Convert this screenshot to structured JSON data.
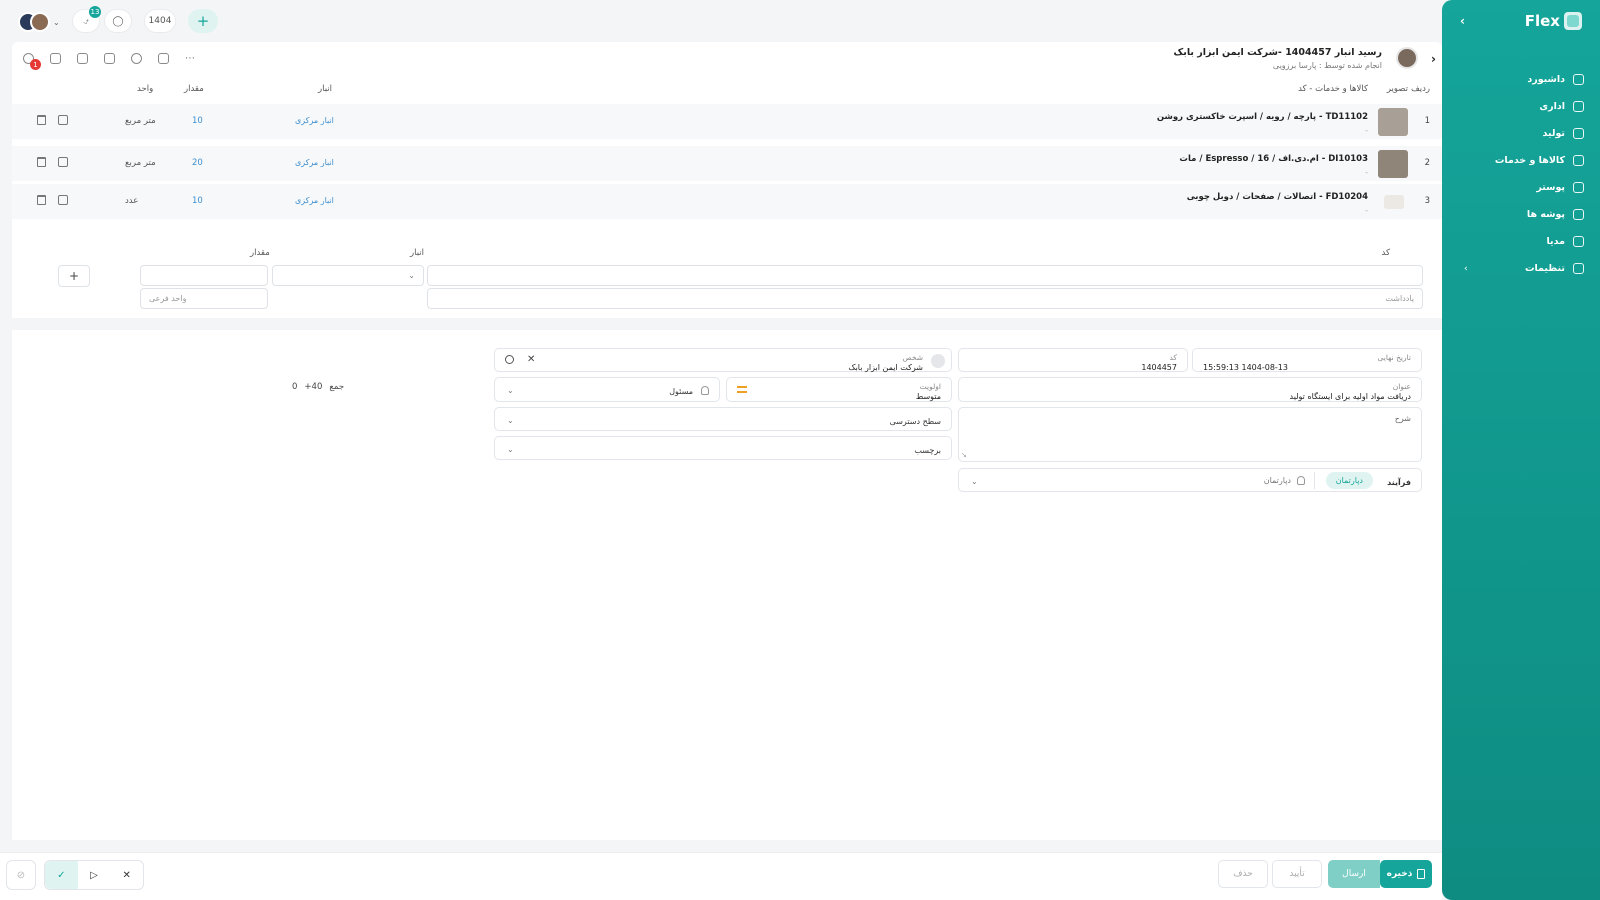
{
  "sidebar": {
    "brand": "Flex",
    "items": [
      {
        "label": "داشبورد"
      },
      {
        "label": "اداری"
      },
      {
        "label": "تولید"
      },
      {
        "label": "کالاها و خدمات"
      },
      {
        "label": "پوستر"
      },
      {
        "label": "پوشه ها"
      },
      {
        "label": "مدیا"
      },
      {
        "label": "تنظیمات"
      }
    ]
  },
  "topbar": {
    "notification_count": "13",
    "year": "1404",
    "add_glyph": "+"
  },
  "header": {
    "title": "رسید انبار 1404457 -شرکت ایمن ابزار بابک",
    "subtitle": "انجام شده توسط : پارسا برزویی",
    "tool_badge": "1"
  },
  "items_table": {
    "columns": {
      "row": "ردیف",
      "image": "تصویر",
      "product": "کالاها و خدمات - کد",
      "warehouse": "انبار",
      "quantity": "مقدار",
      "unit": "واحد"
    },
    "rows": [
      {
        "num": "1",
        "desc": "TD11102 - پارچه / رویه / اسپرت خاکستری روشن",
        "dash": "-",
        "warehouse": "انبار مرکزی",
        "qty": "10",
        "unit": "متر مربع"
      },
      {
        "num": "2",
        "desc": "DI10103 - ام.دی.اف / 16 / Espresso / مات",
        "dash": "-",
        "warehouse": "انبار مرکزی",
        "qty": "20",
        "unit": "متر مربع"
      },
      {
        "num": "3",
        "desc": "FD10204 - اتصالات / صفحات / دوبل چوبی",
        "dash": "-",
        "warehouse": "انبار مرکزی",
        "qty": "10",
        "unit": "عدد"
      }
    ],
    "entry": {
      "code_label": "کد",
      "warehouse_label": "انبار",
      "quantity_label": "مقدار",
      "note_placeholder": "یادداشت",
      "subunit_placeholder": "واحد فرعی",
      "add_glyph": "+"
    }
  },
  "form": {
    "final_date_label": "تاریخ نهایی",
    "final_date_value": "1404-08-13 15:59:13",
    "code_label": "کد",
    "code_value": "1404457",
    "person_label": "شخص",
    "person_value": "شرکت ایمن ابزار بابک",
    "title_label": "عنوان",
    "title_value": "دریافت مواد اولیه برای ایستگاه تولید",
    "priority_label": "اولویت",
    "priority_value": "متوسط",
    "responsible_placeholder": "مسئول",
    "description_label": "شرح",
    "access_level_label": "سطح دسترسی",
    "tag_label": "برچسب",
    "process_label": "فرآیند",
    "department_chip": "دپارتمان",
    "department_placeholder": "دپارتمان",
    "sum_label": "جمع",
    "sum_qty": "40+",
    "sum_value": "0"
  },
  "actions": {
    "save": "ذخیره",
    "send": "ارسال",
    "approve": "تأیید",
    "delete": "حذف"
  }
}
